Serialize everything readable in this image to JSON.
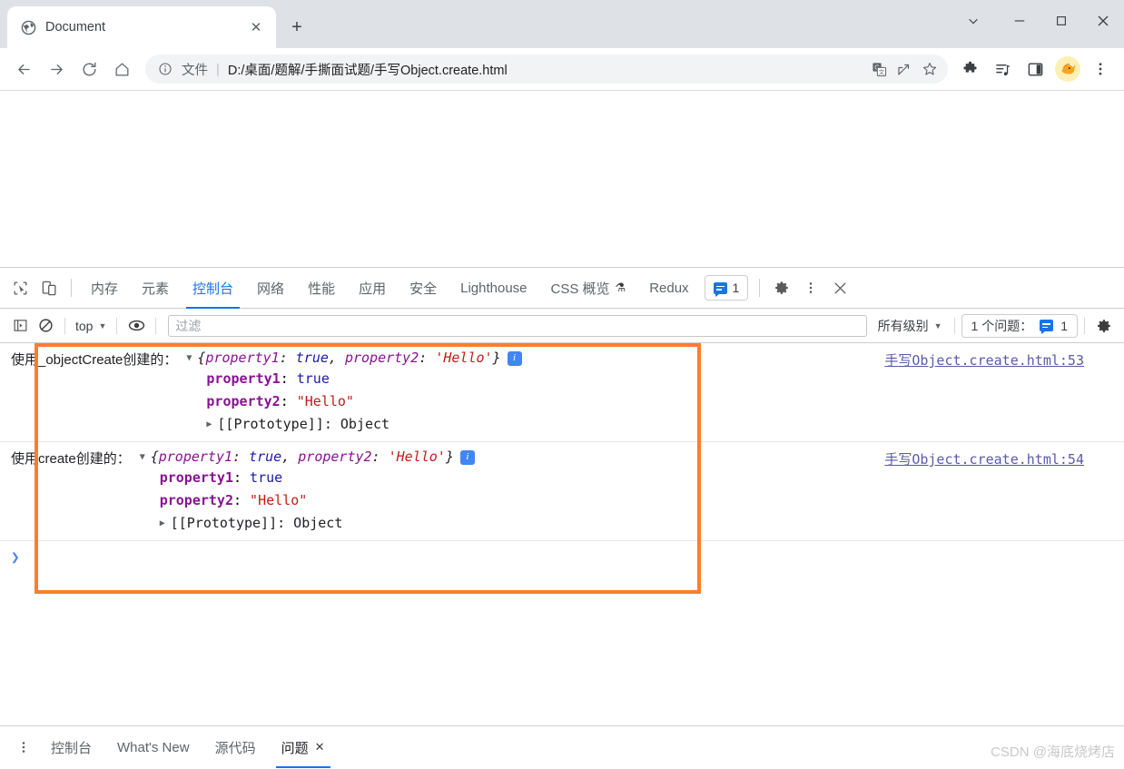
{
  "window": {
    "controls": {
      "tab_search": "tab-search",
      "minimize": "minimize",
      "maximize": "maximize",
      "close": "close"
    }
  },
  "tabstrip": {
    "tabs": [
      {
        "title": "Document",
        "favicon": "globe-icon",
        "close_label": "✕"
      }
    ],
    "new_tab_label": "+"
  },
  "toolbar": {
    "back_label": "←",
    "forward_label": "→",
    "reload_label": "↻",
    "home_label": "⌂",
    "omnibox": {
      "info_label": "ⓘ",
      "scheme": "文件",
      "separator": "|",
      "url": "D:/桌面/题解/手撕面试题/手写Object.create.html",
      "translate_icon": "translate-icon",
      "share_icon": "share-icon",
      "bookmark_icon": "star-icon"
    },
    "extensions_icon": "puzzle-icon",
    "media_icon": "media-playlist-icon",
    "sidepanel_icon": "side-panel-icon",
    "avatar_icon": "profile-avatar",
    "menu_icon": "kebab-menu-icon"
  },
  "devtools": {
    "left_icons": [
      {
        "name": "inspect-element-icon"
      },
      {
        "name": "device-toolbar-icon"
      }
    ],
    "tabs": [
      {
        "label": "内存",
        "active": false
      },
      {
        "label": "元素",
        "active": false
      },
      {
        "label": "控制台",
        "active": true
      },
      {
        "label": "网络",
        "active": false
      },
      {
        "label": "性能",
        "active": false
      },
      {
        "label": "应用",
        "active": false
      },
      {
        "label": "安全",
        "active": false
      },
      {
        "label": "Lighthouse",
        "active": false
      },
      {
        "label": "CSS 概览",
        "active": false,
        "flask": "⚗"
      },
      {
        "label": "Redux",
        "active": false
      }
    ],
    "message_badge": {
      "count": "1",
      "icon": "message-bubble-icon"
    },
    "settings_icon": "gear-icon",
    "more_icon": "kebab-menu-icon",
    "close_icon": "close-icon",
    "filterbar": {
      "sidebar_toggle_icon": "console-sidebar-icon",
      "clear_icon": "clear-console-icon",
      "context": "top",
      "context_caret": "▼",
      "eye_icon": "live-expression-icon",
      "filter_placeholder": "过滤",
      "filter_value": "",
      "level": "所有级别",
      "level_caret": "▼",
      "issues_label": "1 个问题：",
      "issues_count": "1",
      "settings_icon": "gear-icon"
    },
    "console_messages": [
      {
        "label": "使用_objectCreate创建的：",
        "expand_arrow": "▼",
        "preview": {
          "open": "{",
          "key1": "property1",
          "colon1": ": ",
          "val1": "true",
          "comma": ", ",
          "key2": "property2",
          "colon2": ": ",
          "val2": "'Hello'",
          "close": "}"
        },
        "info_icon": "i",
        "properties": [
          {
            "key": "property1",
            "value": "true",
            "type": "bool"
          },
          {
            "key": "property2",
            "value": "\"Hello\"",
            "type": "string"
          }
        ],
        "prototype": {
          "arrow": "▶",
          "label": "[[Prototype]]",
          "value": "Object"
        },
        "source": "手写Object.create.html:53"
      },
      {
        "label": "使用create创建的：",
        "expand_arrow": "▼",
        "preview": {
          "open": "{",
          "key1": "property1",
          "colon1": ": ",
          "val1": "true",
          "comma": ", ",
          "key2": "property2",
          "colon2": ": ",
          "val2": "'Hello'",
          "close": "}"
        },
        "info_icon": "i",
        "properties": [
          {
            "key": "property1",
            "value": "true",
            "type": "bool"
          },
          {
            "key": "property2",
            "value": "\"Hello\"",
            "type": "string"
          }
        ],
        "prototype": {
          "arrow": "▶",
          "label": "[[Prototype]]",
          "value": "Object"
        },
        "source": "手写Object.create.html:54"
      }
    ],
    "prompt": {
      "chevron": "❯",
      "value": ""
    },
    "highlight_color": "#fb7f2b"
  },
  "drawer": {
    "more_icon": "kebab-menu-icon",
    "tabs": [
      {
        "label": "控制台",
        "active": false
      },
      {
        "label": "What's New",
        "active": false
      },
      {
        "label": "源代码",
        "active": false
      },
      {
        "label": "问题",
        "active": true,
        "close": "✕"
      }
    ]
  },
  "watermark": {
    "text": "CSDN @海底烧烤店"
  }
}
